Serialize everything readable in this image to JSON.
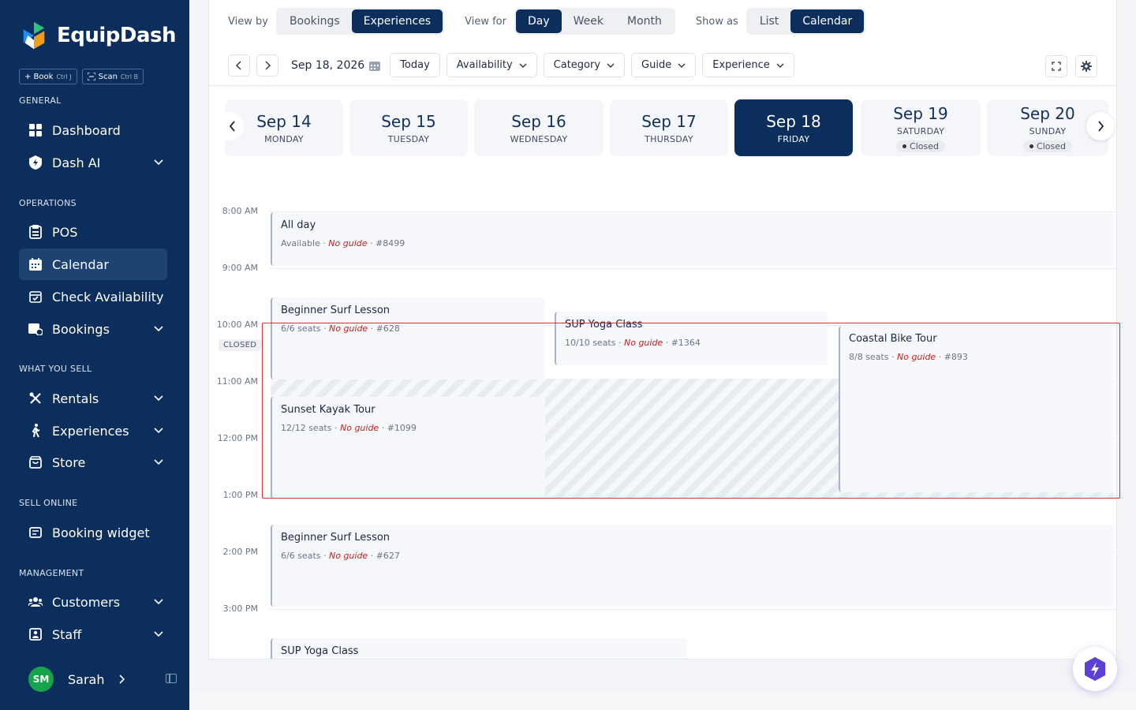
{
  "app": {
    "name": "EquipDash"
  },
  "quick_actions": [
    {
      "label": "+ Book",
      "shortcut": "Ctrl J"
    },
    {
      "label": "Scan",
      "shortcut": "Ctrl B"
    }
  ],
  "sidebar": {
    "sections": {
      "general": "GENERAL",
      "operations": "OPERATIONS",
      "sell": "WHAT YOU SELL",
      "online": "SELL ONLINE",
      "management": "MANAGEMENT"
    },
    "items": {
      "dashboard": "Dashboard",
      "dash_ai": "Dash AI",
      "pos": "POS",
      "calendar": "Calendar",
      "check_availability": "Check Availability",
      "bookings": "Bookings",
      "rentals": "Rentals",
      "experiences": "Experiences",
      "store": "Store",
      "booking_widget": "Booking widget",
      "customers": "Customers",
      "staff": "Staff"
    },
    "user": {
      "initials": "SM",
      "name": "Sarah"
    }
  },
  "toolbar": {
    "view_by_label": "View by",
    "view_by": [
      "Bookings",
      "Experiences"
    ],
    "view_for_label": "View for",
    "view_for": [
      "Day",
      "Week",
      "Month"
    ],
    "show_as_label": "Show as",
    "show_as": [
      "List",
      "Calendar"
    ],
    "date": "Sep 18, 2026",
    "today": "Today",
    "filters": [
      "Availability",
      "Category",
      "Guide",
      "Experience"
    ]
  },
  "days": [
    {
      "date": "Sep 14",
      "weekday": "MONDAY"
    },
    {
      "date": "Sep 15",
      "weekday": "TUESDAY"
    },
    {
      "date": "Sep 16",
      "weekday": "WEDNESDAY"
    },
    {
      "date": "Sep 17",
      "weekday": "THURSDAY"
    },
    {
      "date": "Sep 18",
      "weekday": "FRIDAY"
    },
    {
      "date": "Sep 19",
      "weekday": "SATURDAY",
      "status": "Closed"
    },
    {
      "date": "Sep 20",
      "weekday": "SUNDAY",
      "status": "Closed"
    }
  ],
  "times": [
    "8:00 AM",
    "9:00 AM",
    "10:00 AM",
    "11:00 AM",
    "12:00 PM",
    "1:00 PM",
    "2:00 PM",
    "3:00 PM"
  ],
  "closed_label": "CLOSED",
  "no_guide": "No guide",
  "events": [
    {
      "title": "All day",
      "info": "Available",
      "id": "#8499"
    },
    {
      "title": "Beginner Surf Lesson",
      "info": "6/6 seats",
      "id": "#628"
    },
    {
      "title": "SUP Yoga Class",
      "info": "10/10 seats",
      "id": "#1364"
    },
    {
      "title": "Coastal Bike Tour",
      "info": "8/8 seats",
      "id": "#893"
    },
    {
      "title": "Sunset Kayak Tour",
      "info": "12/12 seats",
      "id": "#1099"
    },
    {
      "title": "Beginner Surf Lesson",
      "info": "6/6 seats",
      "id": "#627"
    },
    {
      "title": "SUP Yoga Class",
      "info": "",
      "id": ""
    }
  ],
  "colors": {
    "brand": "#0b2e5c",
    "accent": "#17a34a",
    "no_guide": "#c0221f",
    "focus": "#d93030"
  }
}
